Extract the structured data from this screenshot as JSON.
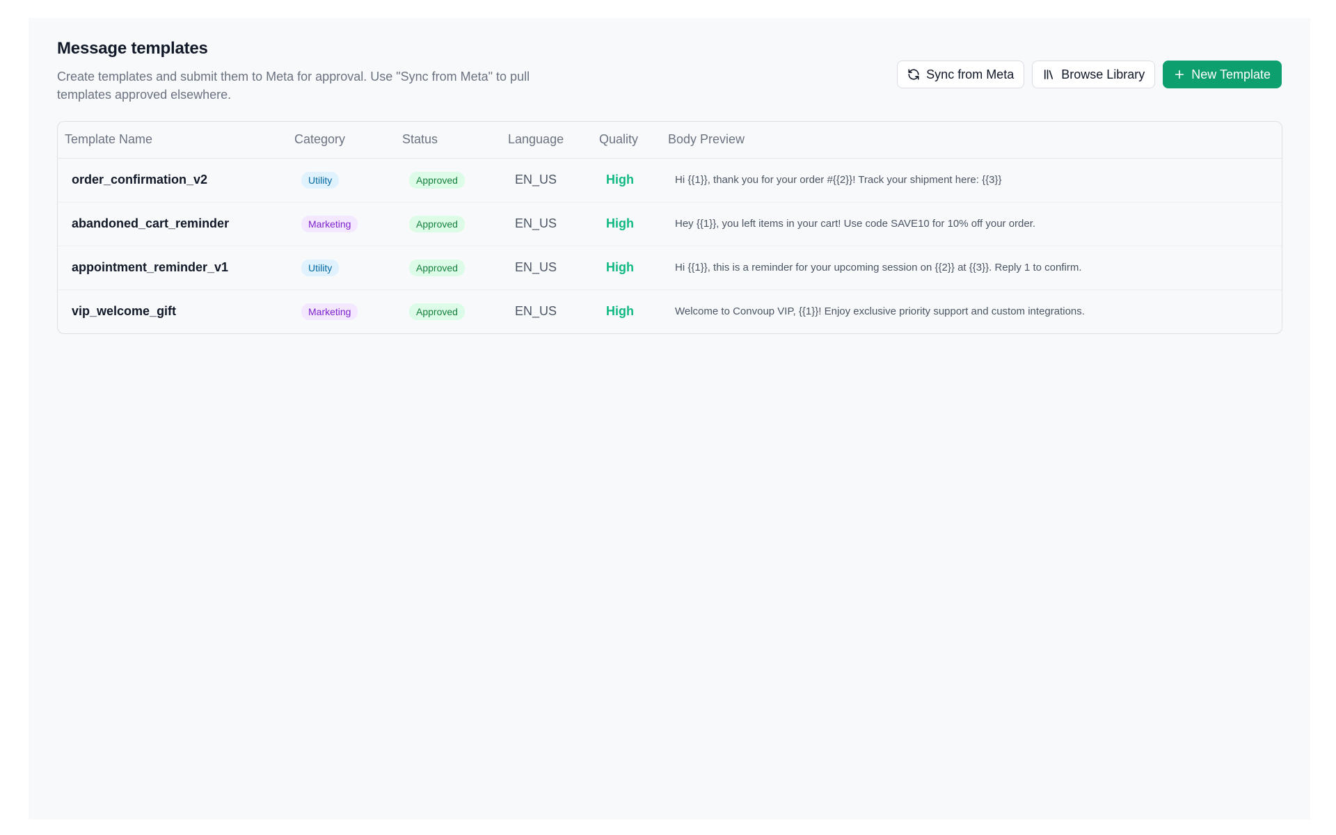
{
  "header": {
    "title": "Message templates",
    "subtitle": "Create templates and submit them to Meta for approval. Use \"Sync from Meta\" to pull templates approved elsewhere."
  },
  "actions": {
    "sync_label": "Sync from Meta",
    "sync_icon": "refresh-icon",
    "library_label": "Browse Library",
    "library_icon": "library-icon",
    "new_label": "New Template",
    "new_icon": "plus-icon"
  },
  "table": {
    "columns": [
      "Template Name",
      "Category",
      "Status",
      "Language",
      "Quality",
      "Body Preview"
    ],
    "rows": [
      {
        "name": "order_confirmation_v2",
        "category": "Utility",
        "status": "Approved",
        "language": "EN_US",
        "quality": "High",
        "preview": "Hi {{1}}, thank you for your order #{{2}}! Track your shipment here: {{3}}"
      },
      {
        "name": "abandoned_cart_reminder",
        "category": "Marketing",
        "status": "Approved",
        "language": "EN_US",
        "quality": "High",
        "preview": "Hey {{1}}, you left items in your cart! Use code SAVE10 for 10% off your order."
      },
      {
        "name": "appointment_reminder_v1",
        "category": "Utility",
        "status": "Approved",
        "language": "EN_US",
        "quality": "High",
        "preview": "Hi {{1}}, this is a reminder for your upcoming session on {{2}} at {{3}}. Reply 1 to confirm."
      },
      {
        "name": "vip_welcome_gift",
        "category": "Marketing",
        "status": "Approved",
        "language": "EN_US",
        "quality": "High",
        "preview": "Welcome to Convoup VIP, {{1}}! Enjoy exclusive priority support and custom integrations."
      }
    ]
  },
  "colors": {
    "primary": "#0e9f6e",
    "quality_high": "#10b981",
    "utility_badge": "#0369a1",
    "marketing_badge": "#7e22ce",
    "approved_badge": "#15803d"
  }
}
